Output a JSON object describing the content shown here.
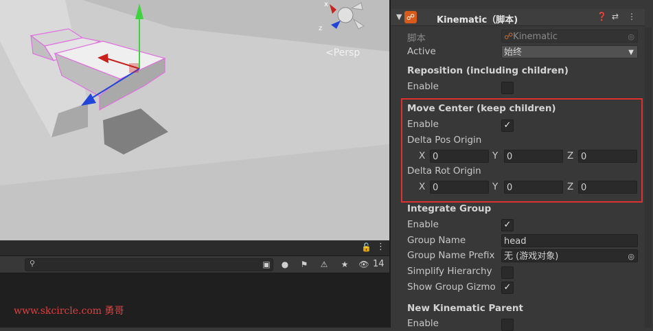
{
  "scene": {
    "view_mode": "<Persp",
    "gizmo_axes": {
      "x": "x",
      "z": "z"
    }
  },
  "lower_panel": {
    "count": "14"
  },
  "watermark": "www.skcircle.com 勇哥",
  "inspector": {
    "component": {
      "title": "Kinematic（脚本)",
      "script_label": "脚本",
      "script_value": "Kinematic",
      "active_label": "Active",
      "active_value": "始终"
    },
    "reposition": {
      "title": "Reposition (including children)",
      "enable_label": "Enable",
      "enable_checked": false
    },
    "move_center": {
      "title": "Move Center (keep children)",
      "enable_label": "Enable",
      "enable_checked": true,
      "delta_pos_label": "Delta Pos Origin",
      "delta_pos": {
        "x_label": "X",
        "x": "0",
        "y_label": "Y",
        "y": "0",
        "z_label": "Z",
        "z": "0"
      },
      "delta_rot_label": "Delta Rot Origin",
      "delta_rot": {
        "x_label": "X",
        "x": "0",
        "y_label": "Y",
        "y": "0",
        "z_label": "Z",
        "z": "0"
      }
    },
    "integrate_group": {
      "title": "Integrate Group",
      "enable_label": "Enable",
      "enable_checked": true,
      "group_name_label": "Group Name",
      "group_name_value": "head",
      "group_name_prefix_label": "Group Name Prefix",
      "group_name_prefix_value": "无 (游戏对象)",
      "simplify_hierarchy_label": "Simplify Hierarchy",
      "simplify_hierarchy_checked": false,
      "show_group_gizmo_label": "Show Group Gizmo",
      "show_group_gizmo_checked": true
    },
    "new_kinematic_parent": {
      "title": "New Kinematic Parent",
      "enable_label": "Enable"
    }
  },
  "colors": {
    "highlight": "#e03131",
    "panel_bg": "#383838",
    "field_bg": "#2a2a2a",
    "axis_y": "#3fd33f",
    "axis_x": "#c8201c",
    "axis_z": "#2045d8",
    "selection_outline": "#e070e0"
  }
}
